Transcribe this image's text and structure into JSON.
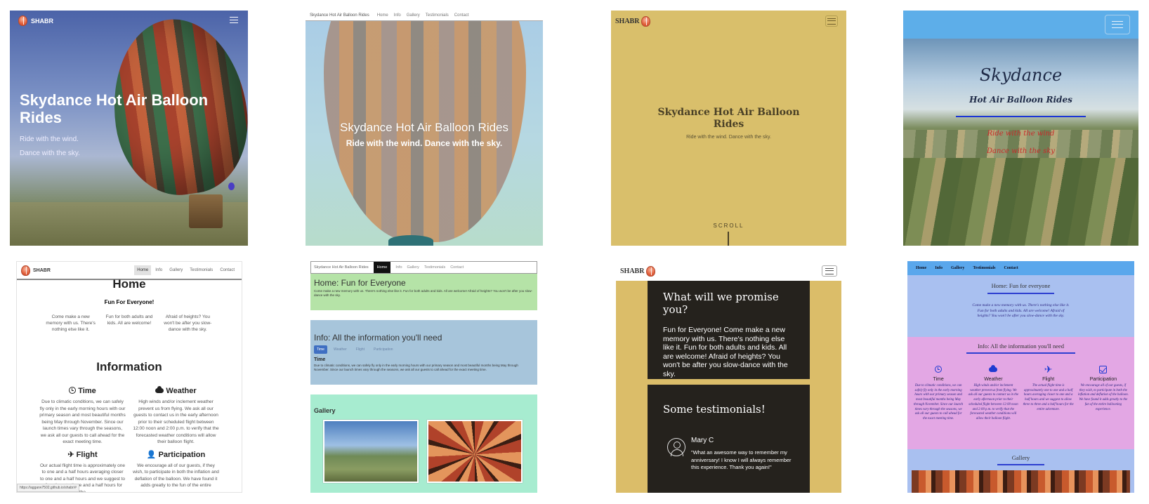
{
  "colors": {
    "p3_bg": "#d9bf6b",
    "p4_topbar": "#5daee9",
    "p6_home": "#b5e3a7",
    "p6_info": "#a7c5db",
    "p6_gallery": "#a7ecd0",
    "p7_card": "#25221d",
    "p8_pink": "#e3a7e4",
    "p8_blue": "#a9c0f0",
    "accent_red": "#c92a2a"
  },
  "p1": {
    "brand": "SHABR",
    "title": "Skydance Hot Air Balloon Rides",
    "tag1": "Ride with the wind.",
    "tag2": "Dance with the sky."
  },
  "p2": {
    "brand": "Skydance Hot Air Balloon Rides",
    "nav": [
      "Home",
      "Info",
      "Gallery",
      "Testimonials",
      "Contact"
    ],
    "title": "Skydance Hot Air Balloon Rides",
    "subtitle": "Ride with the wind. Dance with the sky."
  },
  "p3": {
    "brand": "SHABR",
    "title": "Skydance Hot Air Balloon Rides",
    "subtitle": "Ride with the wind. Dance with the sky.",
    "scroll": "SCROLL"
  },
  "p4": {
    "title": "Skydance",
    "subtitle": "Hot Air Balloon Rides",
    "line1": "Ride with the wind",
    "line2": "Dance with the sky"
  },
  "p5": {
    "brand": "SHABR",
    "nav": [
      "Home",
      "Info",
      "Gallery",
      "Testimonials",
      "Contact"
    ],
    "home_title": "Home",
    "home_lede": "Fun For Everyone!",
    "home_cols": [
      "Come make a new memory with us. There's nothing else like it.",
      "Fun for both adults and kids. All are welcome!",
      "Afraid of heights? You won't be after you slow-dance with the sky."
    ],
    "info_title": "Information",
    "items": [
      {
        "title": "Time",
        "text": "Due to climatic conditions, we can safely fly only in the early morning hours with our primary season and most beautiful months being May through November. Since our launch times vary through the seasons, we ask all our guests to call ahead for the exact meeting time."
      },
      {
        "title": "Weather",
        "text": "High winds and/or inclement weather prevent us from flying. We ask all our guests to contact us in the early afternoon prior to their scheduled flight between 12:00 noon and 2:00 p.m. to verify that the forecasted weather conditions will allow their balloon flight."
      },
      {
        "title": "Flight",
        "text": "Our actual flight time is approximately one to one and a half hours averaging closer to one and a half hours and we suggest to allow three to three and a half hours for the"
      },
      {
        "title": "Participation",
        "text": "We encourage all of our guests, if they wish, to participate in both the inflation and deflation of the balloon. We have found it adds greatly to the fun of the entire"
      }
    ],
    "status_url": "https://aggarw7502.github.io/shabr/#"
  },
  "p6": {
    "brand": "Skydance Hot Air Balloon Rides",
    "nav": [
      "Home",
      "Info",
      "Gallery",
      "Testimonials",
      "Contact"
    ],
    "home_title": "Home: Fun for Everyone",
    "home_text": "Come make a new memory with us. There's nothing else like it. Fun for both adults and kids. All are welcome! Afraid of heights? You won't be after you slow-dance with the sky.",
    "info_title": "Info: All the information you'll need",
    "tabs": [
      "Time",
      "Weather",
      "Flight",
      "Participation"
    ],
    "time_title": "Time",
    "time_text": "Due to climatic conditions, we can safely fly only in the early morning hours with our primary season and most beautiful months being May through November. Since our launch times vary through the seasons, we ask all our guests to call ahead for the exact meeting time.",
    "gallery_title": "Gallery"
  },
  "p7": {
    "brand": "SHABR",
    "promise_title": "What will we promise you?",
    "promise_text": "Fun for Everyone! Come make a new memory with us. There's nothing else like it. Fun for both adults and kids. All are welcome! Afraid of heights? You won't be after you slow-dance with the sky.",
    "testimonials_title": "Some testimonials!",
    "name": "Mary C",
    "quote": "\"What an awesome way to remember my anniversary! I know I will always remember this experience. Thank you again!\""
  },
  "p8": {
    "nav": [
      "Home",
      "Info",
      "Gallery",
      "Testimonials",
      "Contact"
    ],
    "home_title": "Home: Fun for everyone",
    "home_text": "Come make a new memory with us. There's nothing else like it. Fun for both adults and kids. All are welcome! Afraid of heights? You won't be after you slow-dance with the sky.",
    "info_title": "Info: All the information you'll need",
    "items": [
      {
        "icon": "clock-icon",
        "title": "Time",
        "text": "Due to climatic conditions, we can safely fly only in the early morning hours with our primary season and most beautiful months being May through November. Since our launch times vary through the seasons, we ask all our guests to call ahead for the exact meeting time."
      },
      {
        "icon": "cloud-icon",
        "title": "Weather",
        "text": "High winds and/or inclement weather prevent us from flying. We ask all our guests to contact us in the early afternoon prior to their scheduled flight between 12:00 noon and 2:00 p.m. to verify that the forecasted weather conditions will allow their balloon flight."
      },
      {
        "icon": "plane-icon",
        "title": "Flight",
        "text": "The actual flight time is approximately one to one and a half hours averaging closer to one and a half hours and we suggest to allow three to three and a half hours for the entire adventure."
      },
      {
        "icon": "checkbox-icon",
        "title": "Participation",
        "text": "We encourage all of our guests, if they wish, to participate in both the inflation and deflation of the balloon. We have found it adds greatly to the fun of the entire ballooning experience."
      }
    ],
    "gallery_title": "Gallery"
  }
}
